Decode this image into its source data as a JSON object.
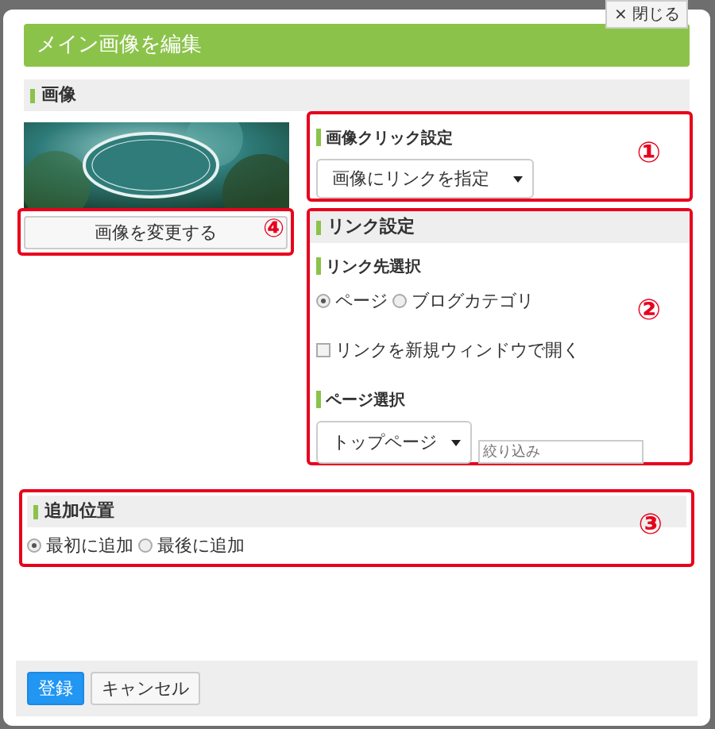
{
  "close_button": "× 閉じる",
  "title": "メイン画像を編集",
  "image_section": {
    "heading": "画像",
    "change_button": "画像を変更する",
    "marker": "④"
  },
  "click_setting": {
    "heading": "画像クリック設定",
    "select": "画像にリンクを指定",
    "marker": "①"
  },
  "link_setting": {
    "heading": "リンク設定",
    "target_heading": "リンク先選択",
    "targets": [
      {
        "label": "ページ",
        "selected": true
      },
      {
        "label": "ブログカテゴリ",
        "selected": false
      }
    ],
    "new_window": {
      "label": "リンクを新規ウィンドウで開く",
      "checked": false
    },
    "page_heading": "ページ選択",
    "page_select": "トップページ",
    "filter": {
      "placeholder": "絞り込み"
    },
    "marker": "②"
  },
  "position": {
    "heading": "追加位置",
    "options": [
      {
        "label": "最初に追加",
        "selected": true
      },
      {
        "label": "最後に追加",
        "selected": false
      }
    ],
    "marker": "③"
  },
  "buttons": [
    {
      "label": "登録",
      "kind": "primary"
    },
    {
      "label": "キャンセル",
      "kind": "default"
    }
  ]
}
